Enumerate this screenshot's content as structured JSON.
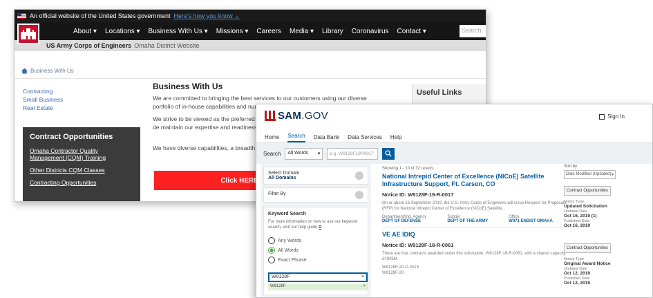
{
  "usace": {
    "gov_banner_text": "An official website of the United States government",
    "gov_banner_link": "Here's how you know ⌄",
    "nav": [
      "About ▾",
      "Locations ▾",
      "Business With Us ▾",
      "Missions ▾",
      "Careers",
      "Media ▾",
      "Library",
      "Coronavirus",
      "Contact ▾"
    ],
    "search_placeholder": "Search",
    "org_name": "US Army Corps of Engineers",
    "district_name": "Omaha District Website",
    "breadcrumb": "Business With Us",
    "left_links": [
      "Contracting",
      "Small Business",
      "Real Estate"
    ],
    "contracts_title": "Contract Opportunities",
    "contracts_links": [
      "Omaha Contractor Quality Management (CQM) Training",
      "Other Districts CQM Classes",
      "Contracting Opportunities"
    ],
    "main_title": "Business With Us",
    "paragraphs": [
      "We are committed to bringing the best services to our customers using our diverse portfolio of in-house capabilities and numerous contract",
      "We strive to be viewed as the preferred Fe services in the areas of water resources, de maintain our expertise and readiness to se",
      "We have diverse capabilities, a breadth of highly qualified contractors on board to ac"
    ],
    "click_here": "Click HERE for",
    "useful_links_title": "Useful Links"
  },
  "sam": {
    "logo_main": "SAM",
    "logo_suffix": ".GOV",
    "sign_in": "Sign In",
    "tabs": [
      "Home",
      "Search",
      "Data Bank",
      "Data Services",
      "Help"
    ],
    "search_label": "Search",
    "search_scope": "All Words",
    "search_placeholder": "e.g. W9128F19R0017",
    "select_domain_label": "Select Domain",
    "select_domain_value": "All Domains",
    "filter_by": "Filter By",
    "keyword_title": "Keyword Search",
    "keyword_help": "For more information on how to use our keyword search, visit our help guide",
    "radios": [
      "Any Words",
      "All Words",
      "Exact Phrase"
    ],
    "keyword_value": "W9128F",
    "keyword_tag": "W9128F",
    "results_count": "Showing 1 - 10 of 32 results",
    "results": [
      {
        "title": "National Intrepid Center of Excellence (NICoE) Satellite Infrastructure Support, Ft. Carson, CO",
        "notice": "Notice ID: W9128F-19-R-0017",
        "desc": "On or about 16 September 2019, the U.S. Army Corps of Engineers will issue Request for Proposals (RFP) for National Intrepid Center of Excellence (NICoE) Satellite...",
        "dept_label": "Department/Ind. Agency",
        "dept_value": "DEPT OF DEFENSE",
        "subtier_label": "Subtier",
        "subtier_value": "DEPT OF THE ARMY",
        "office_label": "Office",
        "office_value": "W071 ENDIST OMAHA"
      },
      {
        "title": "VE AE IDIQ",
        "notice": "Notice ID: W9128F-18-R-0061",
        "desc": "There are four contracts awarded under this solicitation, W9128F-18-R-0061, with a shared capacity of $45M.",
        "extra": [
          "W9128F-20-D-0015",
          "W9128F-20"
        ]
      }
    ],
    "sort_label": "Sort by",
    "sort_value": "Date Modified (Updated)",
    "side_cards": [
      {
        "tag": "Contract Opportunities",
        "type_label": "Notice Type",
        "type_value": "Updated Solicitation",
        "updated_label": "Updated Date",
        "updated_value": "Oct 16, 2019 (1)",
        "published_label": "Published Date",
        "published_value": "Oct 16, 2019"
      },
      {
        "tag": "Contract Opportunities",
        "type_label": "Notice Type",
        "type_value": "Original Award Notice",
        "updated_label": "Updated Date",
        "updated_value": "Oct 12, 2019",
        "published_label": "Published Date",
        "published_value": "Oct 12, 2019"
      }
    ],
    "colors": {
      "primary": "#005ea2",
      "brand_red": "#b51d1d",
      "navy": "#0b2e59"
    }
  }
}
